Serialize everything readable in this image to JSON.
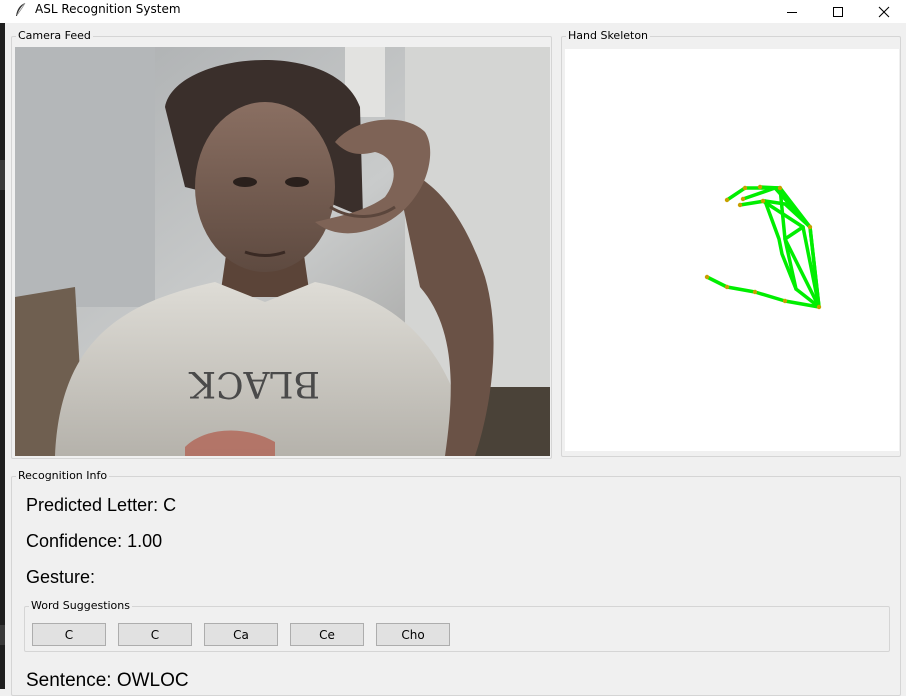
{
  "window": {
    "title": "ASL Recognition System",
    "controls": [
      "minimize",
      "maximize",
      "close"
    ]
  },
  "camera_panel": {
    "label": "Camera Feed"
  },
  "skeleton_panel": {
    "label": "Hand Skeleton",
    "skeleton_color": "#00ee00",
    "joint_color": "#c8a000"
  },
  "info_panel": {
    "label": "Recognition Info",
    "predicted_letter": "Predicted Letter: C",
    "confidence": "Confidence: 1.00",
    "gesture": "Gesture:",
    "sentence": "Sentence: OWLOC"
  },
  "word_suggestions": {
    "label": "Word Suggestions",
    "words": [
      "C",
      "C",
      "Ca",
      "Ce",
      "Cho"
    ]
  }
}
